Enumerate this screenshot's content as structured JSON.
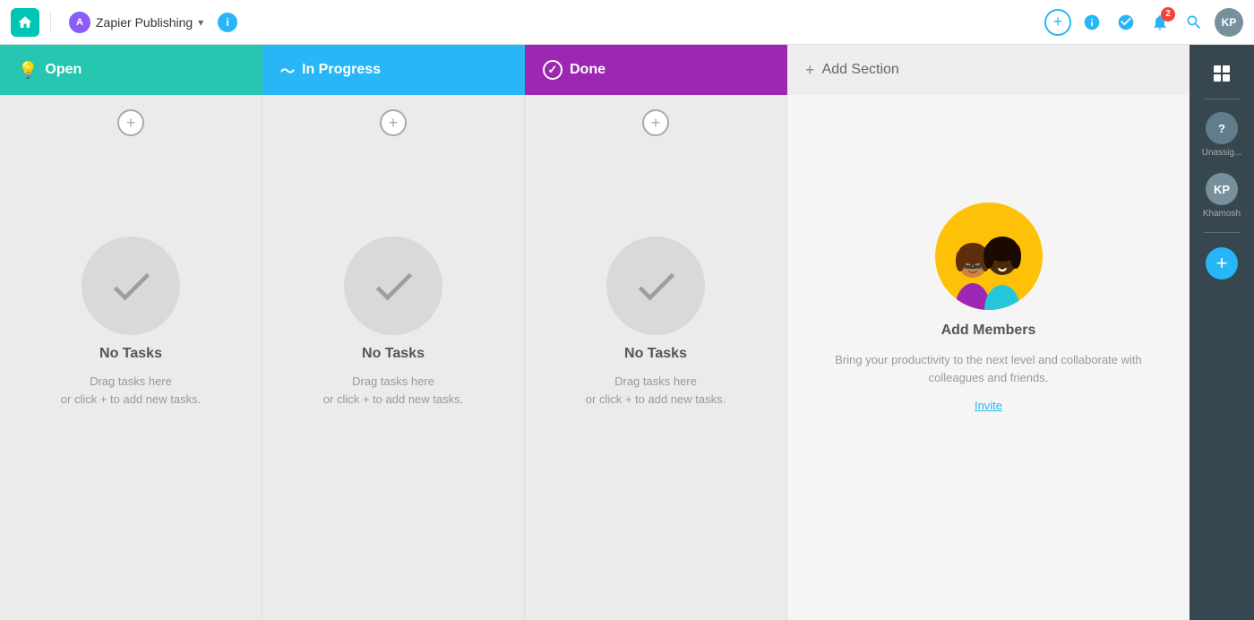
{
  "nav": {
    "home_label": "Home",
    "project_avatar": "A",
    "project_name": "Zapier Publishing",
    "info_label": "i",
    "add_label": "+",
    "notification_count": "2",
    "user_initials": "KP"
  },
  "columns": [
    {
      "id": "open",
      "label": "Open",
      "icon": "bulb",
      "color": "#26c6b0",
      "empty_title": "No Tasks",
      "empty_line1": "Drag tasks here",
      "empty_line2": "or click + to add new tasks."
    },
    {
      "id": "inprogress",
      "label": "In Progress",
      "icon": "pulse",
      "color": "#29b6f6",
      "empty_title": "No Tasks",
      "empty_line1": "Drag tasks here",
      "empty_line2": "or click + to add new tasks."
    },
    {
      "id": "done",
      "label": "Done",
      "icon": "check",
      "color": "#9c27b0",
      "empty_title": "No Tasks",
      "empty_line1": "Drag tasks here",
      "empty_line2": "or click + to add new tasks."
    }
  ],
  "add_section": {
    "label": "Add Section"
  },
  "members_panel": {
    "title": "Add Members",
    "description": "Bring your productivity to the next level and collaborate with colleagues and friends.",
    "invite_label": "Invite"
  },
  "sidebar": {
    "unassigned_label": "Unassig...",
    "user_label": "Khamosh",
    "user_initials": "KP",
    "add_label": "+"
  }
}
